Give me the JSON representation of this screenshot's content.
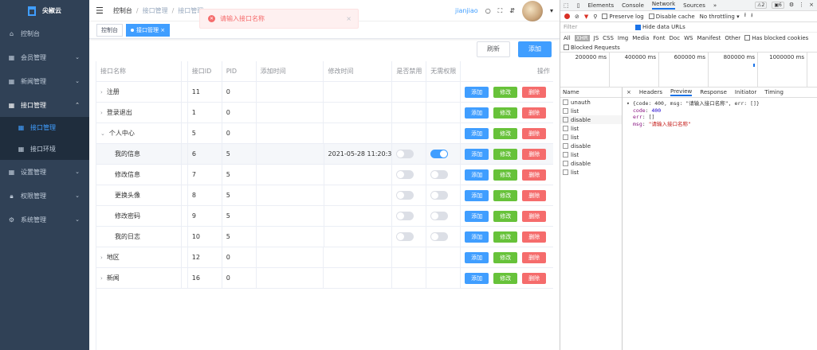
{
  "app": {
    "name": "尖椒云"
  },
  "sidebar": {
    "items": [
      {
        "label": "控制台",
        "icon": "home-icon"
      },
      {
        "label": "会员管理",
        "icon": "grid-icon"
      },
      {
        "label": "新闻管理",
        "icon": "grid-icon"
      },
      {
        "label": "接口管理",
        "icon": "grid-icon"
      },
      {
        "label": "设置管理",
        "icon": "grid-icon"
      },
      {
        "label": "权限管理",
        "icon": "lock-icon"
      },
      {
        "label": "系统管理",
        "icon": "gear-icon"
      }
    ],
    "sub": [
      {
        "label": "接口管理"
      },
      {
        "label": "接口环境"
      }
    ]
  },
  "header": {
    "crumb1": "控制台",
    "crumb2": "接口管理",
    "crumb3": "接口管理",
    "user": "jianjiao"
  },
  "tags": {
    "t1": "控制台",
    "t2": "接口管理"
  },
  "toolbar": {
    "refresh": "刷新",
    "add": "添加"
  },
  "toast": {
    "message": "请输入接口名称"
  },
  "table": {
    "headers": [
      "接口名称",
      "",
      "接口ID",
      "PID",
      "添加时间",
      "修改时间",
      "是否禁用",
      "无需权限",
      "操作"
    ],
    "rows": [
      {
        "name": "注册",
        "id": "11",
        "pid": "0",
        "added": "",
        "modified": "",
        "disabled": null,
        "nopower": null,
        "arrow": "›",
        "level": 0
      },
      {
        "name": "登录退出",
        "id": "1",
        "pid": "0",
        "added": "",
        "modified": "",
        "disabled": null,
        "nopower": null,
        "arrow": "›",
        "level": 0
      },
      {
        "name": "个人中心",
        "id": "5",
        "pid": "0",
        "added": "",
        "modified": "",
        "disabled": null,
        "nopower": null,
        "arrow": "⌄",
        "level": 0
      },
      {
        "name": "我的信息",
        "id": "6",
        "pid": "5",
        "added": "",
        "modified": "2021-05-28 11:20:38",
        "disabled": false,
        "nopower": true,
        "arrow": "",
        "level": 1
      },
      {
        "name": "修改信息",
        "id": "7",
        "pid": "5",
        "added": "",
        "modified": "",
        "disabled": false,
        "nopower": false,
        "arrow": "",
        "level": 1
      },
      {
        "name": "更换头像",
        "id": "8",
        "pid": "5",
        "added": "",
        "modified": "",
        "disabled": false,
        "nopower": false,
        "arrow": "",
        "level": 1
      },
      {
        "name": "修改密码",
        "id": "9",
        "pid": "5",
        "added": "",
        "modified": "",
        "disabled": false,
        "nopower": false,
        "arrow": "",
        "level": 1
      },
      {
        "name": "我的日志",
        "id": "10",
        "pid": "5",
        "added": "",
        "modified": "",
        "disabled": false,
        "nopower": false,
        "arrow": "",
        "level": 1
      },
      {
        "name": "地区",
        "id": "12",
        "pid": "0",
        "added": "",
        "modified": "",
        "disabled": null,
        "nopower": null,
        "arrow": "›",
        "level": 0
      },
      {
        "name": "新闻",
        "id": "16",
        "pid": "0",
        "added": "",
        "modified": "",
        "disabled": null,
        "nopower": null,
        "arrow": "›",
        "level": 0
      }
    ],
    "actions": {
      "add": "添加",
      "edit": "修改",
      "del": "删除"
    }
  },
  "devtools": {
    "tabs": [
      "Elements",
      "Console",
      "Network",
      "Sources",
      "»"
    ],
    "warn": "2",
    "info": "6",
    "opts": {
      "preserve": "Preserve log",
      "cache": "Disable cache",
      "throttle": "No throttling"
    },
    "filter": "Filter",
    "hide": "Hide data URLs",
    "types": [
      "All",
      "XHR",
      "JS",
      "CSS",
      "Img",
      "Media",
      "Font",
      "Doc",
      "WS",
      "Manifest",
      "Other"
    ],
    "blockedCookies": "Has blocked cookies",
    "blockedReq": "Blocked Requests",
    "timeline": [
      "200000 ms",
      "400000 ms",
      "600000 ms",
      "800000 ms",
      "1000000 ms"
    ],
    "nameHeader": "Name",
    "names": [
      "unauth",
      "list",
      "disable",
      "list",
      "list",
      "disable",
      "list",
      "disable",
      "list"
    ],
    "detailTabs": [
      "×",
      "Headers",
      "Preview",
      "Response",
      "Initiator",
      "Timing"
    ],
    "preview": {
      "line1": "▾ {code: 400, msg: \"请输入接口名称\", err: []}",
      "codeKey": "code",
      "codeVal": "400",
      "errKey": "err",
      "errVal": "[]",
      "msgKey": "msg",
      "msgVal": "\"请输入接口名称\""
    }
  }
}
